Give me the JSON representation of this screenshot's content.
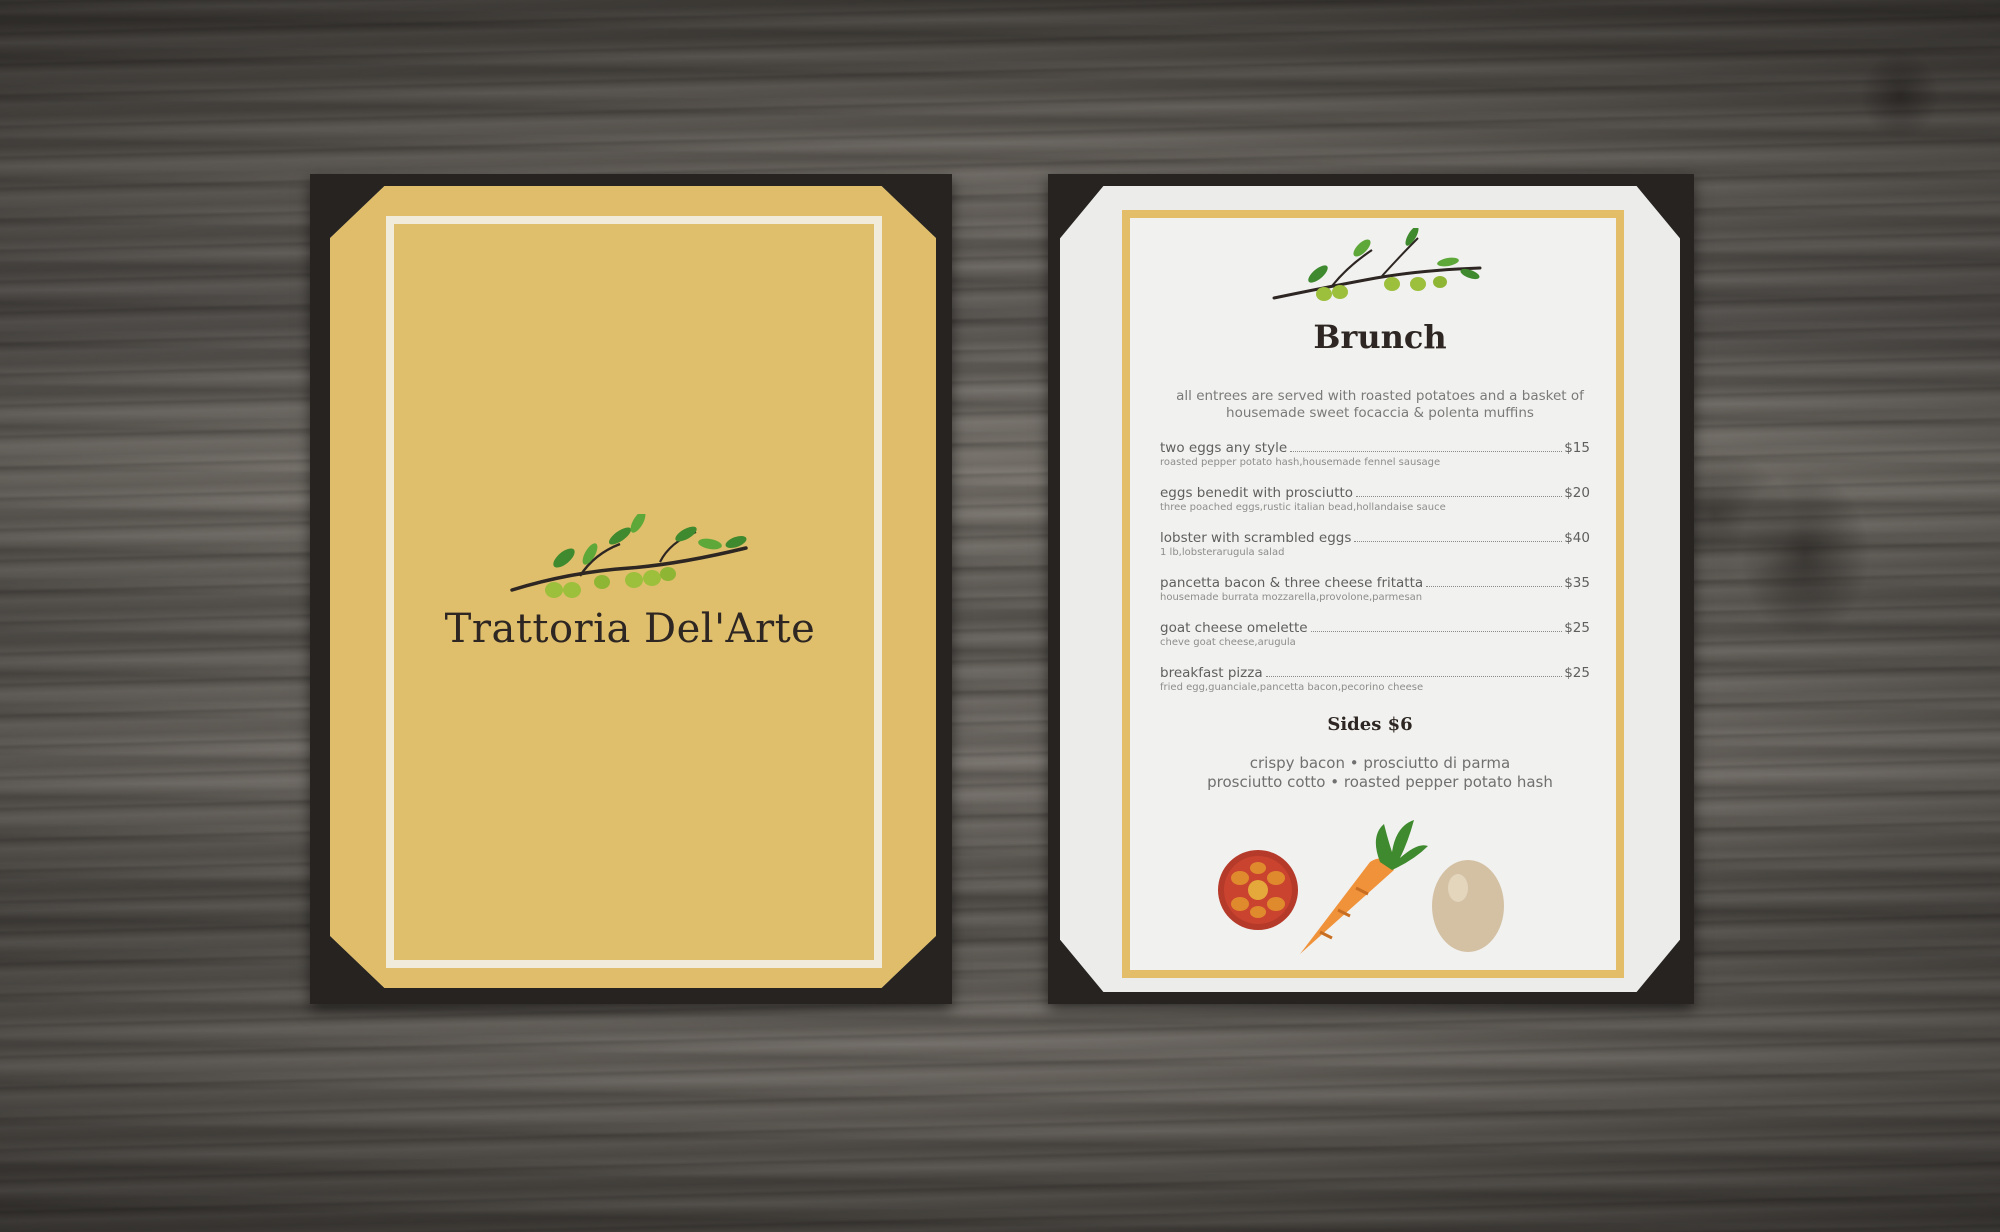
{
  "cover": {
    "restaurant_name": "Trattoria Del'Arte"
  },
  "menu": {
    "heading": "Brunch",
    "intro_line1": "all entrees are served with roasted potatoes and a basket of",
    "intro_line2": "housemade sweet focaccia & polenta muffins",
    "items": [
      {
        "name": "two eggs any style",
        "price": "$15",
        "desc": "roasted pepper potato hash,housemade fennel sausage"
      },
      {
        "name": "eggs benedit with prosciutto",
        "price": "$20",
        "desc": "three poached eggs,rustic italian bead,hollandaise sauce"
      },
      {
        "name": "lobster with scrambled eggs",
        "price": "$40",
        "desc": "1 lb,lobsterarugula salad"
      },
      {
        "name": "pancetta bacon & three cheese fritatta",
        "price": "$35",
        "desc": "housemade burrata mozzarella,provolone,parmesan"
      },
      {
        "name": "goat cheese omelette",
        "price": "$25",
        "desc": "cheve goat cheese,arugula"
      },
      {
        "name": "breakfast pizza",
        "price": "$25",
        "desc": "fried egg,guanciale,pancetta bacon,pecorino cheese"
      }
    ],
    "sides_heading": "Sides $6",
    "sides_line1": "crispy bacon • prosciutto di parma",
    "sides_line2": "prosciutto cotto • roasted pepper potato hash"
  },
  "colors": {
    "cover_yellow": "#dfbd6a",
    "frame_gold": "#e3bd68",
    "olive_green": "#9cbf3c",
    "leaf_green": "#3f8a2e"
  },
  "icons": [
    "olive-branch-icon",
    "tomato-icon",
    "carrot-icon",
    "egg-icon"
  ]
}
